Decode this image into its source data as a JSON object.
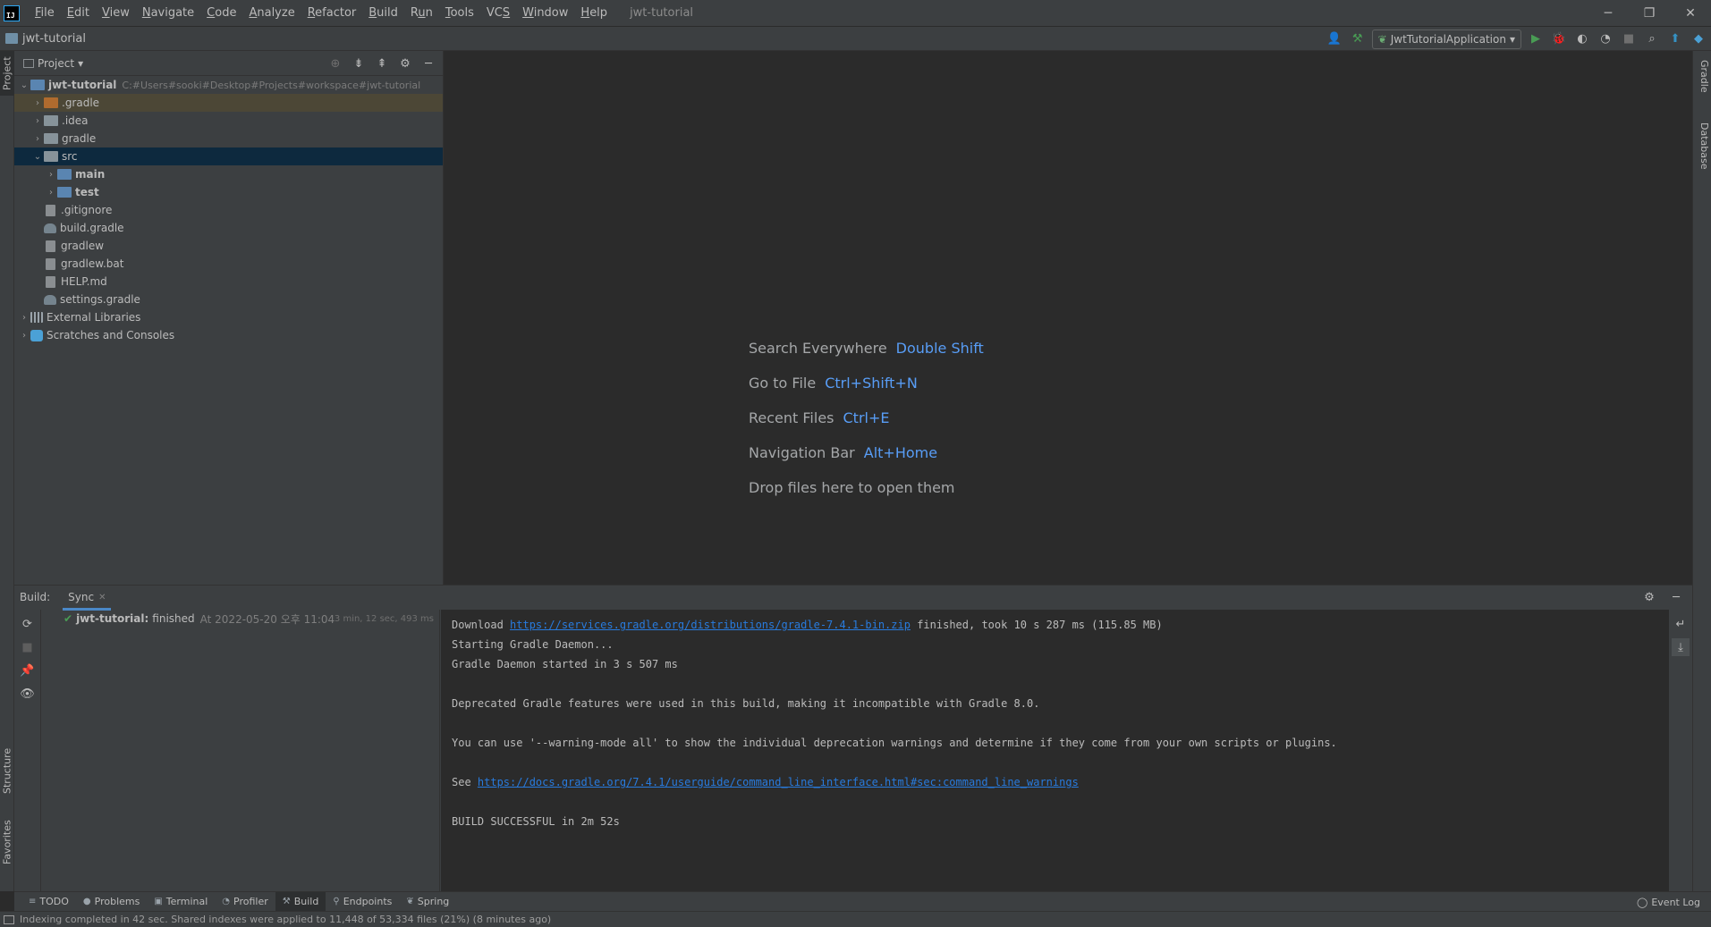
{
  "app": {
    "logo": "IJ",
    "window_title": "jwt-tutorial"
  },
  "menu": {
    "items": [
      {
        "label": "File",
        "mnemonic": "F",
        "rest": "ile"
      },
      {
        "label": "Edit",
        "mnemonic": "E",
        "rest": "dit"
      },
      {
        "label": "View",
        "mnemonic": "V",
        "rest": "iew"
      },
      {
        "label": "Navigate",
        "mnemonic": "N",
        "rest": "avigate"
      },
      {
        "label": "Code",
        "mnemonic": "C",
        "rest": "ode"
      },
      {
        "label": "Analyze",
        "mnemonic": "A",
        "rest": "nalyze"
      },
      {
        "label": "Refactor",
        "mnemonic": "R",
        "rest": "efactor"
      },
      {
        "label": "Build",
        "mnemonic": "B",
        "rest": "uild"
      },
      {
        "label": "Run",
        "mnemonic": "u",
        "pre": "R",
        "rest": "n"
      },
      {
        "label": "Tools",
        "mnemonic": "T",
        "rest": "ools"
      },
      {
        "label": "VCS",
        "mnemonic": "S",
        "pre": "VC",
        "rest": ""
      },
      {
        "label": "Window",
        "mnemonic": "W",
        "rest": "indow"
      },
      {
        "label": "Help",
        "mnemonic": "H",
        "rest": "elp"
      }
    ],
    "window_controls": {
      "minimize": "─",
      "restore": "❐",
      "close": "✕"
    }
  },
  "navbar": {
    "breadcrumb": "jwt-tutorial",
    "run_config": "JwtTutorialApplication"
  },
  "stripes": {
    "left": {
      "project": "Project",
      "structure": "Structure",
      "favorites": "Favorites"
    },
    "right": {
      "gradle": "Gradle",
      "database": "Database"
    }
  },
  "project": {
    "header": "Project",
    "tree": [
      {
        "label": "jwt-tutorial",
        "path": "C:#Users#sooki#Desktop#Projects#workspace#jwt-tutorial",
        "indent": 0,
        "arrow": "⌄",
        "icon": "folder-blue",
        "bold": true
      },
      {
        "label": ".gradle",
        "indent": 1,
        "arrow": "›",
        "icon": "folder-orange",
        "highlight": "orange"
      },
      {
        "label": ".idea",
        "indent": 1,
        "arrow": "›",
        "icon": "folder"
      },
      {
        "label": "gradle",
        "indent": 1,
        "arrow": "›",
        "icon": "folder"
      },
      {
        "label": "src",
        "indent": 1,
        "arrow": "⌄",
        "icon": "folder",
        "highlight": "selected"
      },
      {
        "label": "main",
        "indent": 2,
        "arrow": "›",
        "icon": "folder-blue",
        "bold": true
      },
      {
        "label": "test",
        "indent": 2,
        "arrow": "›",
        "icon": "folder-blue",
        "bold": true
      },
      {
        "label": ".gitignore",
        "indent": 1,
        "arrow": "",
        "icon": "file"
      },
      {
        "label": "build.gradle",
        "indent": 1,
        "arrow": "",
        "icon": "gradle"
      },
      {
        "label": "gradlew",
        "indent": 1,
        "arrow": "",
        "icon": "file"
      },
      {
        "label": "gradlew.bat",
        "indent": 1,
        "arrow": "",
        "icon": "file"
      },
      {
        "label": "HELP.md",
        "indent": 1,
        "arrow": "",
        "icon": "file"
      },
      {
        "label": "settings.gradle",
        "indent": 1,
        "arrow": "",
        "icon": "gradle"
      },
      {
        "label": "External Libraries",
        "indent": 0,
        "arrow": "›",
        "icon": "lib"
      },
      {
        "label": "Scratches and Consoles",
        "indent": 0,
        "arrow": "›",
        "icon": "scratch"
      }
    ]
  },
  "editor": {
    "hints": [
      {
        "text": "Search Everywhere",
        "key": "Double Shift"
      },
      {
        "text": "Go to File",
        "key": "Ctrl+Shift+N"
      },
      {
        "text": "Recent Files",
        "key": "Ctrl+E"
      },
      {
        "text": "Navigation Bar",
        "key": "Alt+Home"
      },
      {
        "text": "Drop files here to open them",
        "key": ""
      }
    ]
  },
  "build": {
    "label": "Build:",
    "tab": "Sync",
    "tree_row": {
      "project": "jwt-tutorial:",
      "status": "finished",
      "at": "At 2022-05-20 오후 11:04",
      "duration": "3 min, 12 sec, 493 ms"
    },
    "console": [
      {
        "pre": "Download ",
        "link": "https://services.gradle.org/distributions/gradle-7.4.1-bin.zip",
        "post": " finished, took 10 s 287 ms (115.85 MB)"
      },
      {
        "pre": "Starting Gradle Daemon...",
        "link": "",
        "post": ""
      },
      {
        "pre": "Gradle Daemon started in 3 s 507 ms",
        "link": "",
        "post": ""
      },
      {
        "pre": "",
        "link": "",
        "post": ""
      },
      {
        "pre": "Deprecated Gradle features were used in this build, making it incompatible with Gradle 8.0.",
        "link": "",
        "post": ""
      },
      {
        "pre": "",
        "link": "",
        "post": ""
      },
      {
        "pre": "You can use '--warning-mode all' to show the individual deprecation warnings and determine if they come from your own scripts or plugins.",
        "link": "",
        "post": ""
      },
      {
        "pre": "",
        "link": "",
        "post": ""
      },
      {
        "pre": "See ",
        "link": "https://docs.gradle.org/7.4.1/userguide/command_line_interface.html#sec:command_line_warnings",
        "post": ""
      },
      {
        "pre": "",
        "link": "",
        "post": ""
      },
      {
        "pre": "BUILD SUCCESSFUL in 2m 52s",
        "link": "",
        "post": ""
      }
    ]
  },
  "bottom_tabs": [
    {
      "label": "TODO",
      "icon": "≡",
      "active": false
    },
    {
      "label": "Problems",
      "icon": "●",
      "active": false
    },
    {
      "label": "Terminal",
      "icon": "▣",
      "active": false
    },
    {
      "label": "Profiler",
      "icon": "◔",
      "active": false
    },
    {
      "label": "Build",
      "icon": "⚒",
      "active": true
    },
    {
      "label": "Endpoints",
      "icon": "⚲",
      "active": false
    },
    {
      "label": "Spring",
      "icon": "❦",
      "active": false
    }
  ],
  "event_log": "Event Log",
  "status": "Indexing completed in 42 sec. Shared indexes were applied to 11,448 of 53,334 files (21%) (8 minutes ago)",
  "colors": {
    "accent": "#589df6",
    "link": "#287bde",
    "success": "#499c54",
    "selection": "#0d293e"
  }
}
